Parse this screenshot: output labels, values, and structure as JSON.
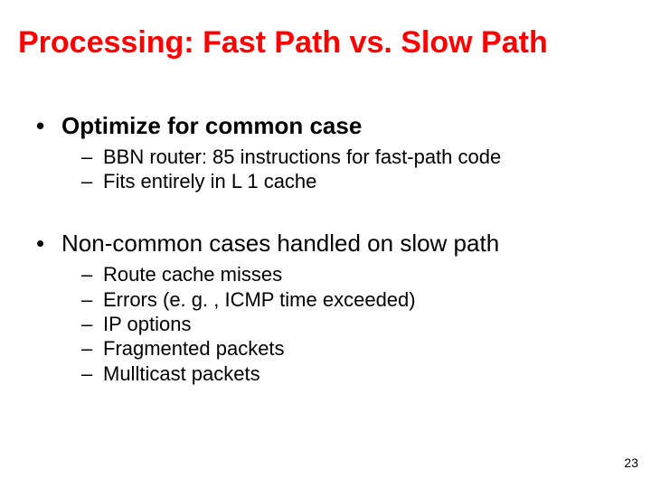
{
  "title": "Processing: Fast Path vs. Slow Path",
  "b1": {
    "text": "Optimize for common case",
    "s1": "BBN router: 85 instructions for fast-path code",
    "s2": "Fits entirely in L 1 cache"
  },
  "b2": {
    "text": "Non-common cases handled on slow path",
    "s1": "Route cache misses",
    "s2": "Errors (e. g. , ICMP time exceeded)",
    "s3": "IP options",
    "s4": "Fragmented packets",
    "s5": "Mullticast packets"
  },
  "page": "23"
}
